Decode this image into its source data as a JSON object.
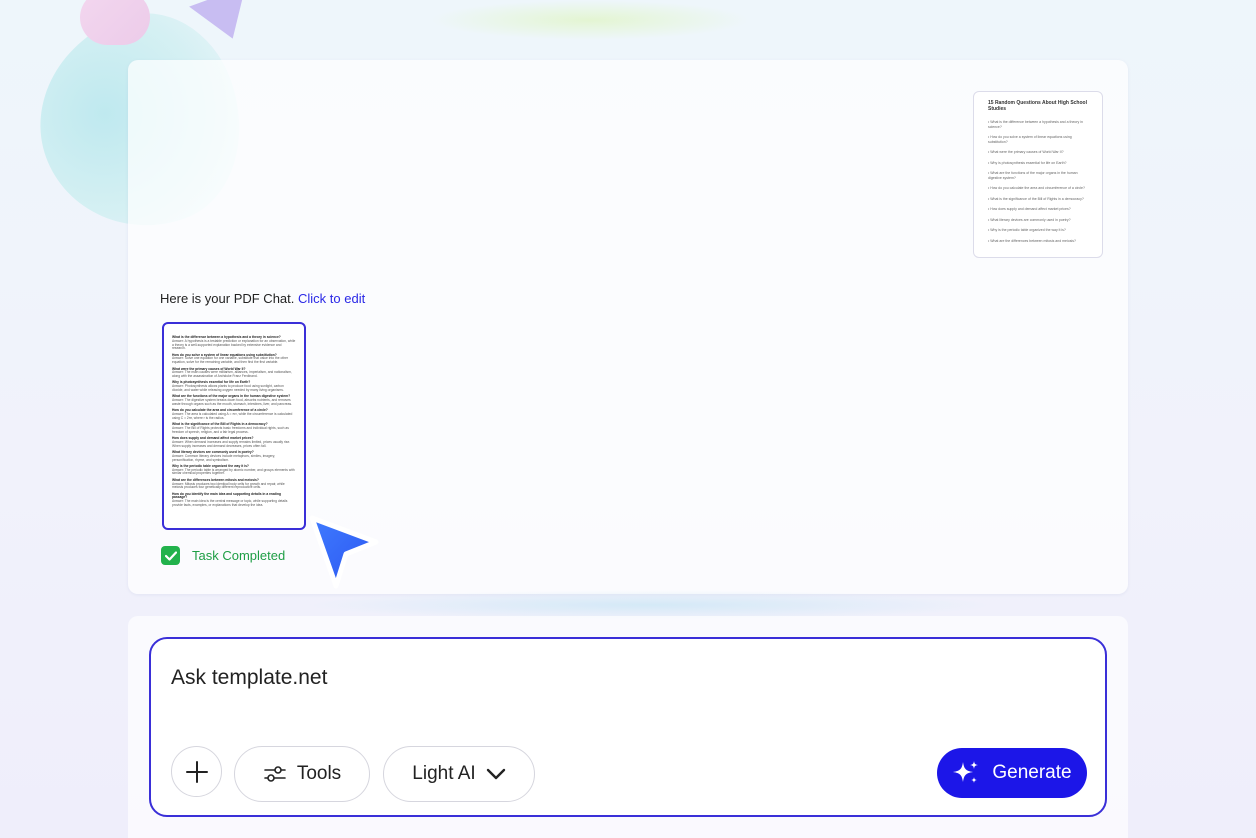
{
  "chat": {
    "message": "Here is your PDF Chat.",
    "edit_link": "Click to edit",
    "task_status": "Task Completed"
  },
  "preview_right": {
    "title": "15 Random Questions About High School Studies",
    "items": [
      "What is the difference between a hypothesis and a theory in science?",
      "How do you solve a system of linear equations using substitution?",
      "What were the primary causes of World War II?",
      "Why is photosynthesis essential for life on Earth?",
      "What are the functions of the major organs in the human digestive system?",
      "How do you calculate the area and circumference of a circle?",
      "What is the significance of the Bill of Rights in a democracy?",
      "How does supply and demand affect market prices?",
      "What literary devices are commonly used in poetry?",
      "Why is the periodic table organized the way it is?",
      "What are the differences between mitosis and meiosis?"
    ]
  },
  "preview_left": {
    "items": [
      {
        "q": "What is the difference between a hypothesis and a theory in science?",
        "a": "Answer: A hypothesis is a testable prediction or explanation for an observation, while a theory is a well-supported explanation backed by extensive evidence and research."
      },
      {
        "q": "How do you solve a system of linear equations using substitution?",
        "a": "Answer: Solve one equation for one variable, substitute that value into the other equation, solve for the remaining variable, and then find the first variable."
      },
      {
        "q": "What were the primary causes of World War II?",
        "a": "Answer: The main causes were militarism, alliances, imperialism, and nationalism, along with the assassination of Archduke Franz Ferdinand."
      },
      {
        "q": "Why is photosynthesis essential for life on Earth?",
        "a": "Answer: Photosynthesis allows plants to produce food using sunlight, carbon dioxide, and water while releasing oxygen needed by many living organisms."
      },
      {
        "q": "What are the functions of the major organs in the human digestive system?",
        "a": "Answer: The digestive system breaks down food, absorbs nutrients, and removes waste through organs such as the mouth, stomach, intestines, liver, and pancreas."
      },
      {
        "q": "How do you calculate the area and circumference of a circle?",
        "a": "Answer: The area is calculated using A = πr², while the circumference is calculated using C = 2πr, where r is the radius."
      },
      {
        "q": "What is the significance of the Bill of Rights in a democracy?",
        "a": "Answer: The Bill of Rights protects basic freedoms and individual rights, such as freedom of speech, religion, and a fair legal process."
      },
      {
        "q": "How does supply and demand affect market prices?",
        "a": "Answer: When demand increases and supply remains limited, prices usually rise. When supply increases and demand decreases, prices often fall."
      },
      {
        "q": "What literary devices are commonly used in poetry?",
        "a": "Answer: Common literary devices include metaphors, similes, imagery, personification, rhyme, and symbolism."
      },
      {
        "q": "Why is the periodic table organized the way it is?",
        "a": "Answer: The periodic table is arranged by atomic number, and groups elements with similar chemical properties together."
      },
      {
        "q": "What are the differences between mitosis and meiosis?",
        "a": "Answer: Mitosis produces two identical body cells for growth and repair, while meiosis produces four genetically different reproductive cells."
      },
      {
        "q": "How do you identify the main idea and supporting details in a reading passage?",
        "a": "Answer: The main idea is the central message or topic, while supporting details provide facts, examples, or explanations that develop the idea."
      }
    ]
  },
  "composer": {
    "placeholder": "Ask template.net",
    "tools_label": "Tools",
    "model_label": "Light AI",
    "generate_label": "Generate"
  },
  "colors": {
    "accent": "#1c16e8",
    "border_accent": "#3a2fd8",
    "success": "#22b24c",
    "link": "#2a28e6"
  }
}
